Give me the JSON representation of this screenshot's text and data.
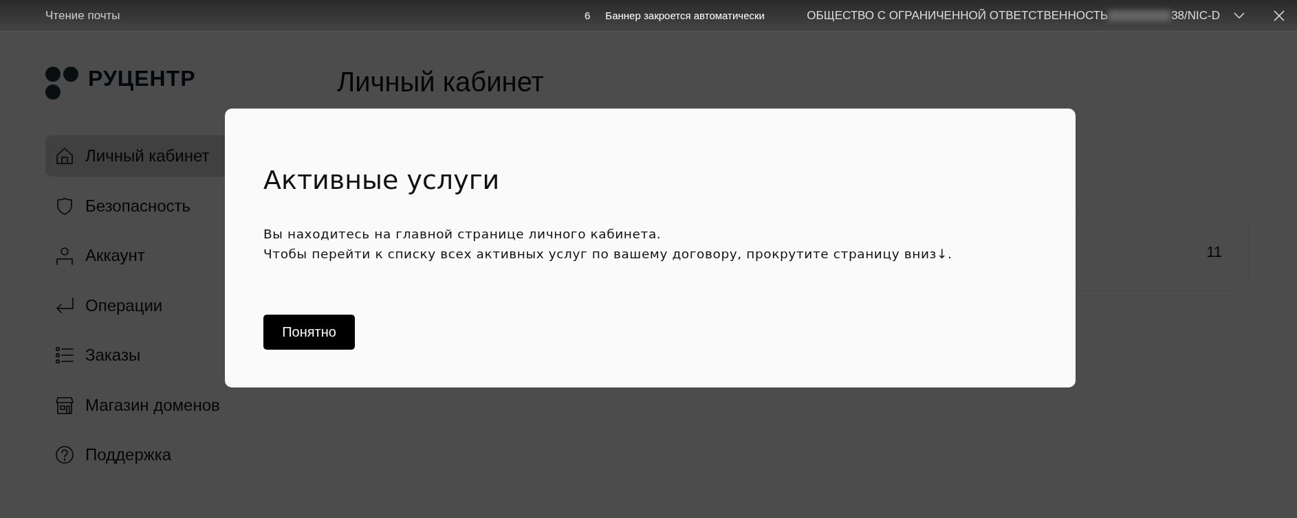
{
  "top_banner": {
    "left_text": "Чтение почты",
    "countdown": "6",
    "message": "Баннер закроется автоматически",
    "organization": "ОБЩЕСТВО С ОГРАНИЧЕННОЙ ОТВЕТСТВЕННОСТЬ",
    "organization_suffix": "38/NIC-D"
  },
  "logo": {
    "text": "РУЦЕНТР"
  },
  "sidebar": {
    "items": [
      {
        "label": "Личный кабинет",
        "kind": "home",
        "selected": true
      },
      {
        "label": "Безопасность",
        "kind": "shield",
        "selected": false
      },
      {
        "label": "Аккаунт",
        "kind": "person",
        "selected": false
      },
      {
        "label": "Операции",
        "kind": "return",
        "selected": false
      },
      {
        "label": "Заказы",
        "kind": "list",
        "selected": false
      },
      {
        "label": "Магазин доменов",
        "kind": "store",
        "selected": false
      },
      {
        "label": "Поддержка",
        "kind": "help",
        "selected": false
      }
    ]
  },
  "page": {
    "title": "Личный кабинет",
    "card_value": "11"
  },
  "modal": {
    "title": "Активные услуги",
    "lines": [
      "Вы находитесь на главной странице личного кабинета.",
      "Чтобы перейти к списку всех активных услуг по вашему договору, прокрутите страницу вниз↓."
    ],
    "button": "Понятно"
  }
}
